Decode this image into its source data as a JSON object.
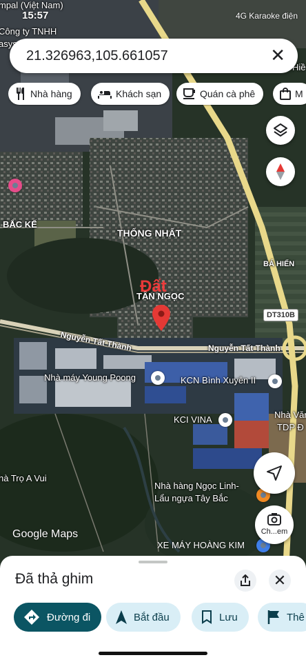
{
  "status_bar": {
    "time": "15:57",
    "right": "4G  Karaoke điện"
  },
  "search": {
    "value": "21.326963,105.661057"
  },
  "chips": [
    {
      "label": "Nhà hàng",
      "icon": "restaurant-icon"
    },
    {
      "label": "Khách sạn",
      "icon": "hotel-icon"
    },
    {
      "label": "Quán cà phê",
      "icon": "coffee-icon"
    },
    {
      "label": "M",
      "icon": "shopping-bag-icon"
    }
  ],
  "map": {
    "area_labels": {
      "thong_nhat": "THỐNG NHẤT",
      "tan_ngoc": "TÂN NGỌC",
      "bac_ke": "BẮC KẾ",
      "ba_hien": "BÁ HIẾN",
      "hien": "Hiề",
      "dat": "Đất",
      "road_nguyen_tat_thanh_1": "Nguyễn Tất Thành",
      "road_nguyen_tat_thanh_2": "Nguyễn Tất Thành",
      "highway": "DT310B",
      "top_left_1": "mpal (Việt Nam)",
      "top_left_2": "Công ty TNHH",
      "top_left_3": "asys"
    },
    "pois": {
      "young_poong": "Nhà máy Young Poong",
      "kcn": "KCN Bình Xuyên II",
      "kci": "KCI VINA",
      "nha_van": "Nhà Văn",
      "tdp": "TDP Đ",
      "nha_tro": "hà Trọ A Vui",
      "nha_hang_1": "Nhà hàng Ngọc Linh-",
      "nha_hang_2": "Lẩu ngựa Tây Bắc",
      "xe_may": "XE MÁY HOÀNG KIM"
    },
    "google_logo": "Google Maps",
    "lens_label": "Ch...em"
  },
  "sheet": {
    "title": "Đã thả ghim",
    "actions": [
      {
        "label": "Đường đi",
        "icon": "directions-icon"
      },
      {
        "label": "Bắt đầu",
        "icon": "navigation-arrow-icon"
      },
      {
        "label": "Lưu",
        "icon": "bookmark-icon"
      },
      {
        "label": "Thê",
        "icon": "flag-icon"
      }
    ]
  },
  "colors": {
    "accent": "#0b5563",
    "secondary": "#d9eef6",
    "pin": "#e53935",
    "road": "#e8d88a"
  }
}
